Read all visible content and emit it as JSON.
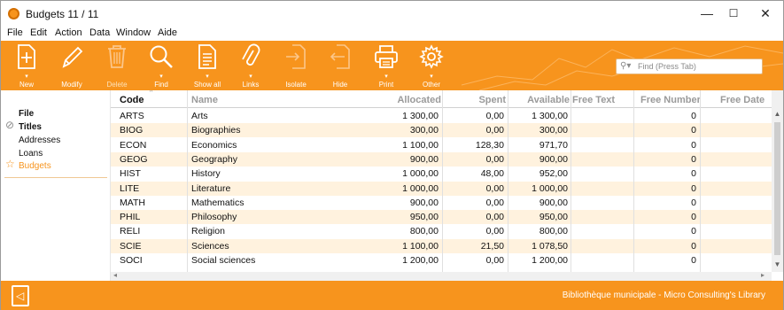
{
  "window": {
    "title": "Budgets   11 / 11",
    "minimize": "—",
    "maximize": "☐",
    "close": "✕"
  },
  "menu": [
    "File",
    "Edit",
    "Action",
    "Data",
    "Window",
    "Aide"
  ],
  "toolbar": {
    "tools": [
      {
        "label": "New",
        "icon": "new-icon",
        "enabled": true,
        "dropdown": true
      },
      {
        "label": "Modify",
        "icon": "pencil-icon",
        "enabled": true,
        "dropdown": false
      },
      {
        "label": "Delete",
        "icon": "trash-icon",
        "enabled": false,
        "dropdown": false
      },
      {
        "label": "Find",
        "icon": "magnifier-icon",
        "enabled": true,
        "dropdown": true
      },
      {
        "label": "Show all",
        "icon": "document-icon",
        "enabled": true,
        "dropdown": true
      },
      {
        "label": "Links",
        "icon": "paperclip-icon",
        "enabled": true,
        "dropdown": true
      },
      {
        "label": "Isolate",
        "icon": "isolate-icon",
        "enabled": true,
        "dropdown": false
      },
      {
        "label": "Hide",
        "icon": "hide-icon",
        "enabled": true,
        "dropdown": false
      },
      {
        "label": "Print",
        "icon": "printer-icon",
        "enabled": true,
        "dropdown": true
      },
      {
        "label": "Other",
        "icon": "gear-icon",
        "enabled": true,
        "dropdown": true
      }
    ],
    "search_placeholder": "Find (Press Tab)"
  },
  "sidebar": {
    "items": [
      {
        "label": "File",
        "icon": "",
        "active": false,
        "bold": true
      },
      {
        "label": "Titles",
        "icon": "paperclip-icon",
        "active": false,
        "bold": true
      },
      {
        "label": "Addresses",
        "icon": "",
        "active": false,
        "bold": false
      },
      {
        "label": "Loans",
        "icon": "",
        "active": false,
        "bold": false
      },
      {
        "label": "Budgets",
        "icon": "star-icon",
        "active": true,
        "bold": false
      }
    ]
  },
  "table": {
    "columns": [
      "Code",
      "Name",
      "Allocated",
      "Spent",
      "Available",
      "Free Text",
      "Free Number",
      "Free Date"
    ],
    "rows": [
      [
        "ARTS",
        "Arts",
        "1 300,00",
        "0,00",
        "1 300,00",
        "",
        "0",
        ""
      ],
      [
        "BIOG",
        "Biographies",
        "300,00",
        "0,00",
        "300,00",
        "",
        "0",
        ""
      ],
      [
        "ECON",
        "Economics",
        "1 100,00",
        "128,30",
        "971,70",
        "",
        "0",
        ""
      ],
      [
        "GEOG",
        "Geography",
        "900,00",
        "0,00",
        "900,00",
        "",
        "0",
        ""
      ],
      [
        "HIST",
        "History",
        "1 000,00",
        "48,00",
        "952,00",
        "",
        "0",
        ""
      ],
      [
        "LITE",
        "Literature",
        "1 000,00",
        "0,00",
        "1 000,00",
        "",
        "0",
        ""
      ],
      [
        "MATH",
        "Mathematics",
        "900,00",
        "0,00",
        "900,00",
        "",
        "0",
        ""
      ],
      [
        "PHIL",
        "Philosophy",
        "950,00",
        "0,00",
        "950,00",
        "",
        "0",
        ""
      ],
      [
        "RELI",
        "Religion",
        "800,00",
        "0,00",
        "800,00",
        "",
        "0",
        ""
      ],
      [
        "SCIE",
        "Sciences",
        "1 100,00",
        "21,50",
        "1 078,50",
        "",
        "0",
        ""
      ],
      [
        "SOCI",
        "Social sciences",
        "1 200,00",
        "0,00",
        "1 200,00",
        "",
        "0",
        ""
      ]
    ]
  },
  "status": {
    "text": "Bibliothèque municipale - Micro Consulting's Library"
  },
  "colors": {
    "accent": "#f7941d",
    "row_alt": "#fff2de",
    "active_nav": "#f7941d"
  }
}
